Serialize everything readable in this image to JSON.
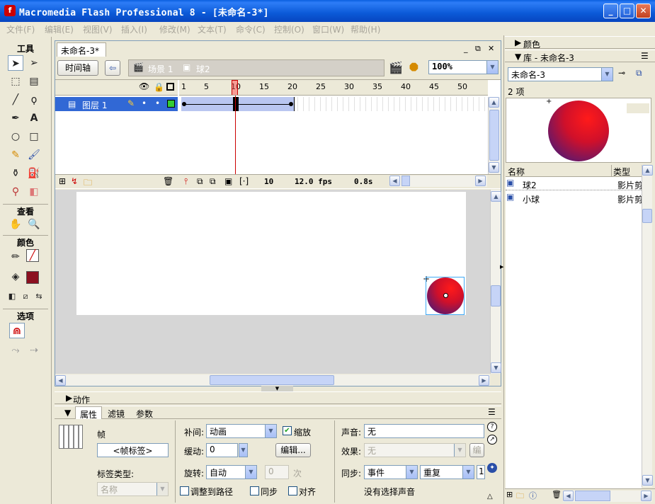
{
  "window": {
    "title": "Macromedia Flash Professional 8 - [未命名-3*]",
    "min": "_",
    "max": "□",
    "close": "✕"
  },
  "menu": [
    "文件(F)",
    "编辑(E)",
    "视图(V)",
    "插入(I)",
    "修改(M)",
    "文本(T)",
    "命令(C)",
    "控制(O)",
    "窗口(W)",
    "帮助(H)"
  ],
  "tools": {
    "section_tools": "工具",
    "section_view": "查看",
    "section_colors": "颜色",
    "section_options": "选项"
  },
  "document": {
    "tab": "未命名-3*",
    "timeline_button": "时间轴",
    "scene": "场景 1",
    "symbol": "球2",
    "zoom": "100%"
  },
  "timeline": {
    "layer": "图层 1",
    "ruler": [
      "1",
      "5",
      "10",
      "15",
      "20",
      "25",
      "30",
      "35",
      "40",
      "45",
      "50"
    ],
    "current_frame": "10",
    "fps": "12.0 fps",
    "time": "0.8s"
  },
  "panels": {
    "actions": "动作",
    "tabs": [
      "属性",
      "滤镜",
      "参数"
    ]
  },
  "properties": {
    "frame_label": "帧",
    "frame_label_placeholder": "<帧标签>",
    "label_type_title": "标签类型:",
    "label_type": "名称",
    "tween_label": "补间:",
    "tween": "动画",
    "scale_label": "缩放",
    "ease_label": "缓动:",
    "ease": "0",
    "edit_button": "编辑...",
    "rotate_label": "旋转:",
    "rotate": "自动",
    "rotate_times": "0",
    "times_unit": "次",
    "orient_label": "调整到路径",
    "sync_label": "同步",
    "snap_label": "对齐",
    "sound_label": "声音:",
    "sound": "无",
    "effect_label": "效果:",
    "effect": "无",
    "effect_edit": "编辑",
    "sync2_label": "同步:",
    "sync2": "事件",
    "repeat": "重复",
    "repeat_count": "1",
    "no_sound": "没有选择声音"
  },
  "right": {
    "color_panel": "颜色",
    "library_panel": "库 - 未命名-3",
    "library_select": "未命名-3",
    "item_count": "2 项",
    "col_name": "名称",
    "col_type": "类型",
    "items": [
      {
        "name": "球2",
        "type": "影片剪"
      },
      {
        "name": "小球",
        "type": "影片剪"
      }
    ]
  }
}
